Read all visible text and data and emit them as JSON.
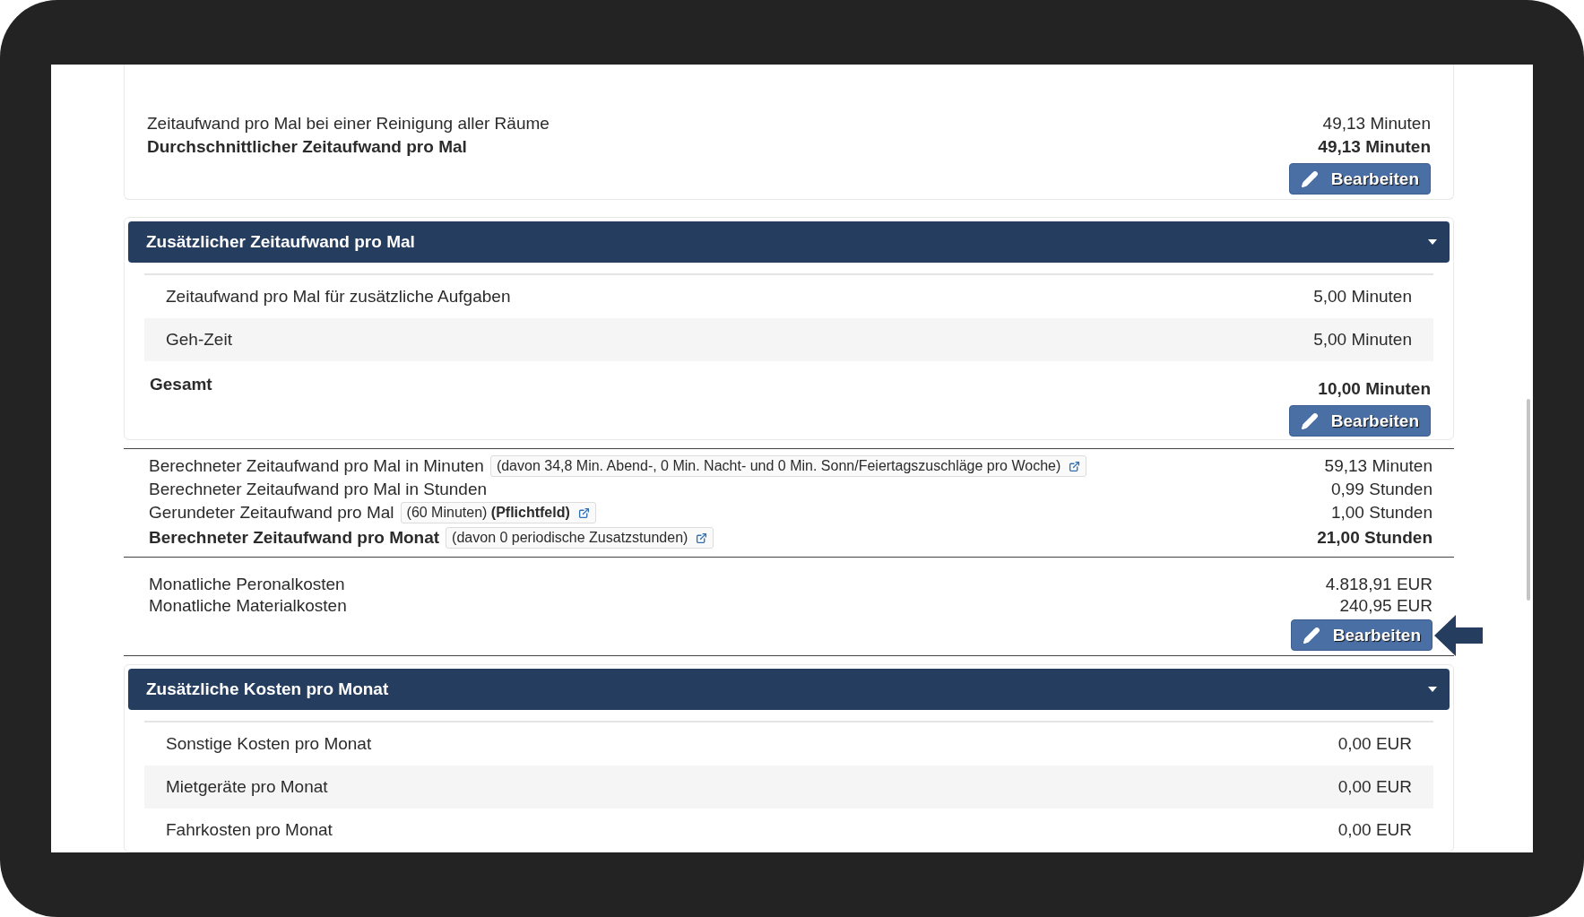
{
  "summary": {
    "lines": [
      {
        "label": "Zeitaufwand pro Mal bei einer Reinigung aller Räume",
        "value": "49,13 Minuten",
        "bold": false
      },
      {
        "label": "Durchschnittlicher Zeitaufwand pro Mal",
        "value": "49,13 Minuten",
        "bold": true
      }
    ],
    "button": "Bearbeiten"
  },
  "extra_time_panel": {
    "title": "Zusätzlicher Zeitaufwand pro Mal",
    "rows": [
      {
        "label": "Zeitaufwand pro Mal für zusätzliche Aufgaben",
        "value": "5,00 Minuten"
      },
      {
        "label": "Geh-Zeit",
        "value": "5,00 Minuten"
      }
    ],
    "total_label": "Gesamt",
    "total_value": "10,00 Minuten",
    "button": "Bearbeiten"
  },
  "calculation": {
    "lines": [
      {
        "label": "Berechneter Zeitaufwand pro Mal in Minuten",
        "bold": false,
        "note": "(davon 34,8 Min. Abend-, 0 Min. Nacht- und 0 Min. Sonn/Feiertagszuschläge pro Woche)",
        "value": "59,13 Minuten"
      },
      {
        "label": "Berechneter Zeitaufwand pro Mal in Stunden",
        "bold": false,
        "value": "0,99 Stunden"
      },
      {
        "label": "Gerundeter Zeitaufwand pro Mal",
        "bold": false,
        "note": "(60 Minuten) **(Pflichtfeld)**",
        "value": "1,00 Stunden"
      },
      {
        "label": "Berechneter Zeitaufwand pro Monat",
        "bold": true,
        "note": "(davon 0 periodische Zusatzstunden)",
        "value": "21,00 Stunden"
      }
    ]
  },
  "costs": {
    "lines": [
      {
        "label": "Monatliche Peronalkosten",
        "value": "4.818,91 EUR"
      },
      {
        "label": "Monatliche Materialkosten",
        "value": "240,95 EUR"
      }
    ],
    "button": "Bearbeiten"
  },
  "extra_costs_panel": {
    "title": "Zusätzliche Kosten pro Monat",
    "rows": [
      {
        "label": "Sonstige Kosten pro Monat",
        "value": "0,00 EUR"
      },
      {
        "label": "Mietgeräte pro Monat",
        "value": "0,00 EUR"
      },
      {
        "label": "Fahrkosten pro Monat",
        "value": "0,00 EUR"
      }
    ]
  }
}
